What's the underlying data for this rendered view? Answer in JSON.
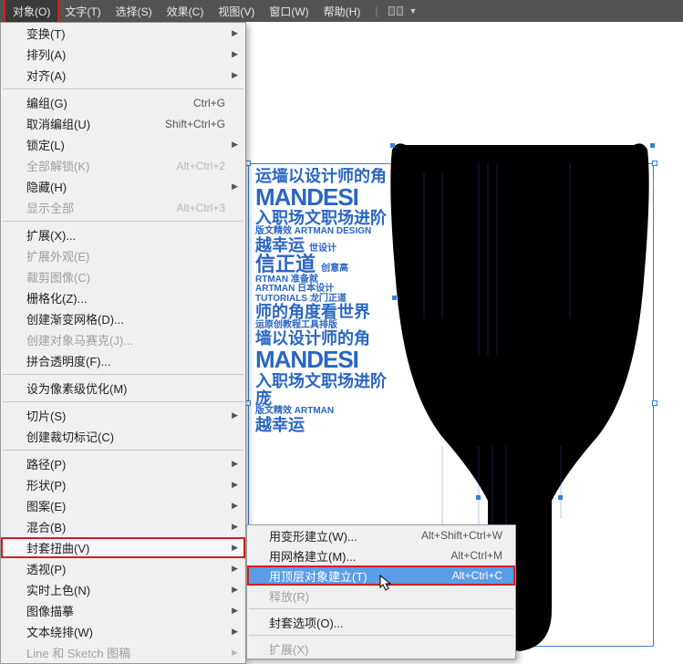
{
  "menubar": {
    "items": [
      {
        "label": "对象(O)",
        "active": true
      },
      {
        "label": "文字(T)"
      },
      {
        "label": "选择(S)"
      },
      {
        "label": "效果(C)"
      },
      {
        "label": "视图(V)"
      },
      {
        "label": "窗口(W)"
      },
      {
        "label": "帮助(H)"
      }
    ]
  },
  "dropdown": {
    "items": [
      {
        "label": "变换(T)",
        "sub": true
      },
      {
        "label": "排列(A)",
        "sub": true
      },
      {
        "label": "对齐(A)",
        "sub": true
      },
      {
        "divider": true
      },
      {
        "label": "编组(G)",
        "shortcut": "Ctrl+G"
      },
      {
        "label": "取消编组(U)",
        "shortcut": "Shift+Ctrl+G"
      },
      {
        "label": "锁定(L)",
        "sub": true
      },
      {
        "label": "全部解锁(K)",
        "shortcut": "Alt+Ctrl+2",
        "disabled": true
      },
      {
        "label": "隐藏(H)",
        "sub": true
      },
      {
        "label": "显示全部",
        "shortcut": "Alt+Ctrl+3",
        "disabled": true
      },
      {
        "divider": true
      },
      {
        "label": "扩展(X)..."
      },
      {
        "label": "扩展外观(E)",
        "disabled": true
      },
      {
        "label": "裁剪图像(C)",
        "disabled": true
      },
      {
        "label": "栅格化(Z)..."
      },
      {
        "label": "创建渐变网格(D)..."
      },
      {
        "label": "创建对象马赛克(J)...",
        "disabled": true
      },
      {
        "label": "拼合透明度(F)..."
      },
      {
        "divider": true
      },
      {
        "label": "设为像素级优化(M)"
      },
      {
        "divider": true
      },
      {
        "label": "切片(S)",
        "sub": true
      },
      {
        "label": "创建裁切标记(C)"
      },
      {
        "divider": true
      },
      {
        "label": "路径(P)",
        "sub": true
      },
      {
        "label": "形状(P)",
        "sub": true
      },
      {
        "label": "图案(E)",
        "sub": true
      },
      {
        "label": "混合(B)",
        "sub": true
      },
      {
        "label": "封套扭曲(V)",
        "sub": true,
        "hl": true
      },
      {
        "label": "透视(P)",
        "sub": true
      },
      {
        "label": "实时上色(N)",
        "sub": true
      },
      {
        "label": "图像描摹",
        "sub": true
      },
      {
        "label": "文本绕排(W)",
        "sub": true
      },
      {
        "label": "Line 和 Sketch 图稿",
        "sub": true,
        "disabled": true
      }
    ]
  },
  "submenu": {
    "items": [
      {
        "label": "用变形建立(W)...",
        "shortcut": "Alt+Shift+Ctrl+W"
      },
      {
        "label": "用网格建立(M)...",
        "shortcut": "Alt+Ctrl+M"
      },
      {
        "label": "用顶层对象建立(T)",
        "shortcut": "Alt+Ctrl+C",
        "hl": true
      },
      {
        "label": "释放(R)",
        "disabled": true
      },
      {
        "divider": true
      },
      {
        "label": "封套选项(O)..."
      },
      {
        "divider": true
      },
      {
        "label": "扩展(X)",
        "disabled": true
      }
    ]
  },
  "artwork": {
    "lines": [
      "运墙以设计师的角",
      "MANDESI",
      "入职场文职场进阶",
      "版文精效",
      "ARTMAN",
      "DESIGN",
      "越幸运",
      "世设计",
      "信正道",
      "创意高",
      "RTMAN",
      "准备就",
      "ARTMAN",
      "日本设计",
      "TUTORIALS",
      "龙门正道",
      "师的角度看世界",
      "运原创教程工具排版",
      "墙以设计师的角",
      "MANDESI",
      "入职场文职场进阶庞",
      "版文精效",
      "ARTMAN",
      "越幸运"
    ]
  }
}
